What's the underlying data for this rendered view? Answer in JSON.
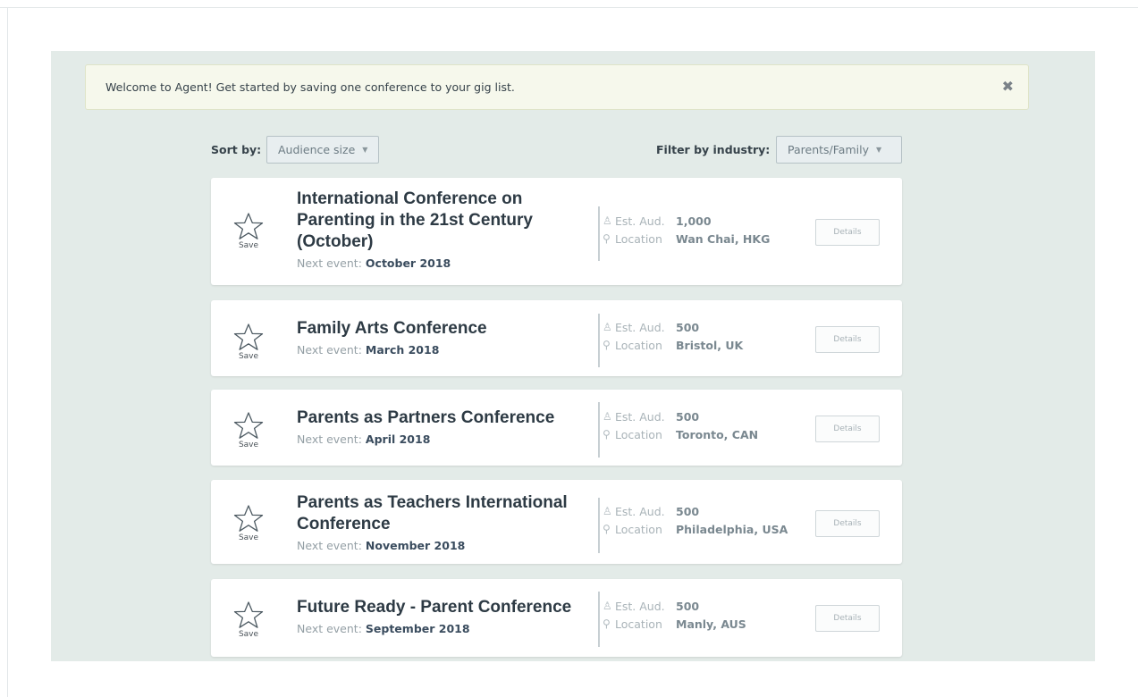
{
  "banner": {
    "message": "Welcome to Agent! Get started by saving one conference to your gig list.",
    "close_glyph": "✖"
  },
  "controls": {
    "sort_label": "Sort by:",
    "sort_value": "Audience size",
    "filter_label": "Filter by industry:",
    "filter_value": "Parents/Family"
  },
  "labels": {
    "save": "Save",
    "next_event": "Next event:",
    "est_aud": "Est. Aud.",
    "location": "Location",
    "details": "Details"
  },
  "conferences": [
    {
      "title_lines": [
        "International Conference on",
        "Parenting in the 21st Century",
        "(October)"
      ],
      "next_event": "October 2018",
      "est_aud": "1,000",
      "location": "Wan Chai, HKG"
    },
    {
      "title_lines": [
        "Family Arts Conference"
      ],
      "next_event": "March 2018",
      "est_aud": "500",
      "location": "Bristol, UK"
    },
    {
      "title_lines": [
        "Parents as Partners Conference"
      ],
      "next_event": "April 2018",
      "est_aud": "500",
      "location": "Toronto, CAN"
    },
    {
      "title_lines": [
        "Parents as Teachers International",
        "Conference"
      ],
      "next_event": "November 2018",
      "est_aud": "500",
      "location": "Philadelphia, USA"
    },
    {
      "title_lines": [
        "Future Ready - Parent Conference"
      ],
      "next_event": "September 2018",
      "est_aud": "500",
      "location": "Manly, AUS"
    }
  ]
}
